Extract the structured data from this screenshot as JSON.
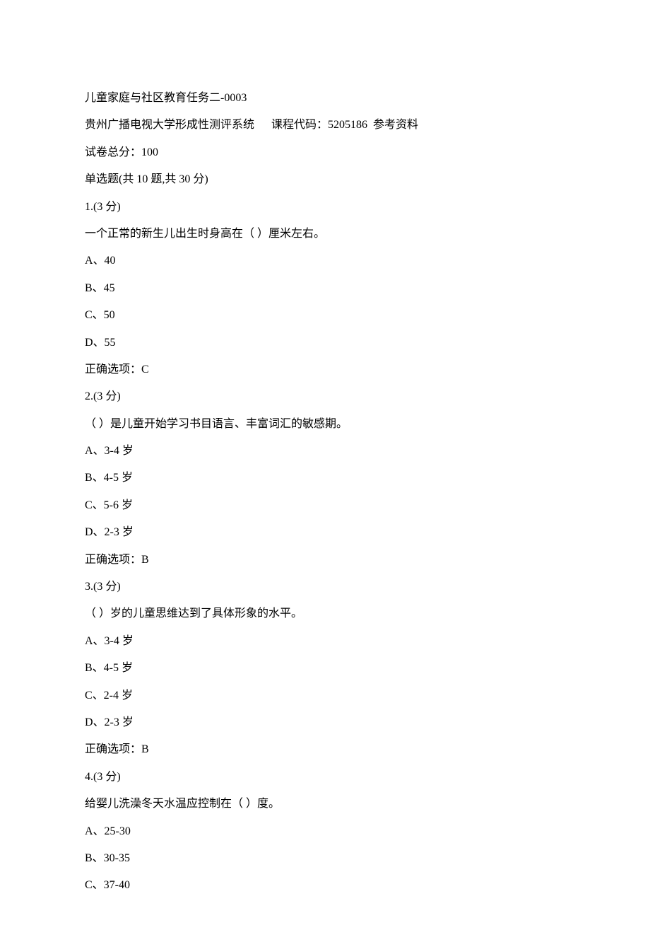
{
  "doc": {
    "title": "儿童家庭与社区教育任务二-0003",
    "school": "贵州广播电视大学形成性测评系统",
    "course_label": "课程代码：",
    "course_code": "5205186",
    "ref": "参考资料",
    "total_label": "试卷总分：",
    "total_score": "100",
    "section_header": "单选题(共 10 题,共 30 分)"
  },
  "q1": {
    "num": "1.(3 分)",
    "stem": "一个正常的新生儿出生时身高在（ ）厘米左右。",
    "a": "A、40",
    "b": "B、45",
    "c": "C、50",
    "d": "D、55",
    "ans": "正确选项：C"
  },
  "q2": {
    "num": "2.(3 分)",
    "stem": "（ ）是儿童开始学习书目语言、丰富词汇的敏感期。",
    "a": "A、3-4 岁",
    "b": "B、4-5 岁",
    "c": "C、5-6 岁",
    "d": "D、2-3 岁",
    "ans": "正确选项：B"
  },
  "q3": {
    "num": "3.(3 分)",
    "stem": "（ ）岁的儿童思维达到了具体形象的水平。",
    "a": "A、3-4 岁",
    "b": "B、4-5 岁",
    "c": "C、2-4 岁",
    "d": "D、2-3 岁",
    "ans": "正确选项：B"
  },
  "q4": {
    "num": "4.(3 分)",
    "stem": "给婴儿洗澡冬天水温应控制在（ ）度。",
    "a": "A、25-30",
    "b": "B、30-35",
    "c": "C、37-40"
  }
}
